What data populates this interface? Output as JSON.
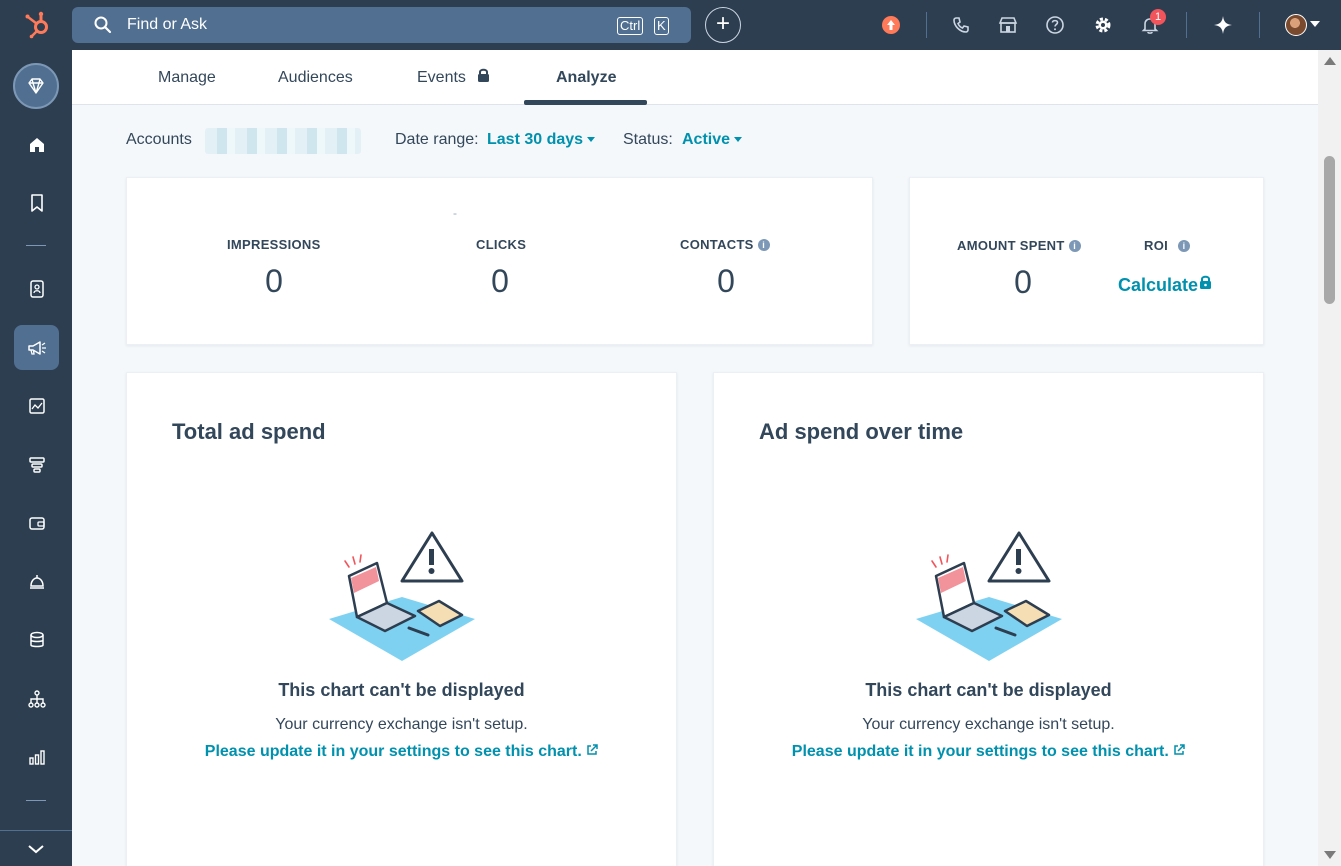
{
  "topbar": {
    "search_placeholder": "Find or Ask",
    "shortcut_ctrl": "Ctrl",
    "shortcut_k": "K",
    "notifications_count": "1"
  },
  "tabs": [
    {
      "label": "Manage"
    },
    {
      "label": "Audiences"
    },
    {
      "label": "Events"
    },
    {
      "label": "Analyze"
    }
  ],
  "filters": {
    "accounts_label": "Accounts",
    "date_range_label": "Date range:",
    "date_range_value": "Last 30 days",
    "status_label": "Status:",
    "status_value": "Active"
  },
  "metrics": {
    "dash": "-",
    "impressions_label": "IMPRESSIONS",
    "impressions_value": "0",
    "clicks_label": "CLICKS",
    "clicks_value": "0",
    "contacts_label": "CONTACTS",
    "contacts_value": "0",
    "amount_spent_label": "AMOUNT SPENT",
    "amount_spent_value": "0",
    "roi_label": "ROI",
    "roi_link": "Calculate"
  },
  "charts": [
    {
      "title": "Total ad spend",
      "empty_title": "This chart can't be displayed",
      "empty_sub": "Your currency exchange isn't setup.",
      "empty_link": "Please update it in your settings to see this chart."
    },
    {
      "title": "Ad spend over time",
      "empty_title": "This chart can't be displayed",
      "empty_sub": "Your currency exchange isn't setup.",
      "empty_link": "Please update it in your settings to see this chart."
    }
  ],
  "colors": {
    "nav_bg": "#2d3e50",
    "link": "#0091ae",
    "text": "#33475b",
    "brand_orange": "#ff7a59"
  }
}
